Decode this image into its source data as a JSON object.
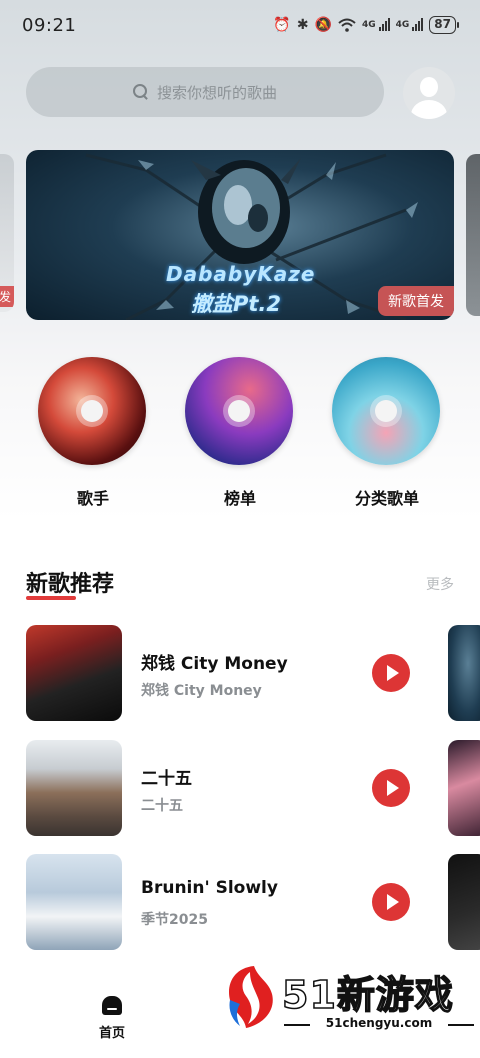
{
  "status_bar": {
    "time": "09:21",
    "net1": "4G",
    "net2": "4G",
    "battery": "87"
  },
  "search": {
    "placeholder": "搜索你想听的歌曲"
  },
  "banner": {
    "title": "DababyKaze",
    "subtitle": "撤盐Pt.2",
    "tag": "新歌首发",
    "left_peek_tag": "发"
  },
  "categories": [
    {
      "label": "歌手"
    },
    {
      "label": "榜单"
    },
    {
      "label": "分类歌单"
    }
  ],
  "new_songs": {
    "title": "新歌推荐",
    "more": "更多",
    "items": [
      {
        "title": "郑钱 City Money",
        "subtitle": "郑钱 City Money"
      },
      {
        "title": "二十五",
        "subtitle": "二十五"
      },
      {
        "title": "Brunin' Slowly",
        "subtitle": "季节2025"
      }
    ]
  },
  "bottom_nav": {
    "home_label": "首页"
  },
  "watermark": {
    "brand": "51新游戏",
    "url": "51chengyu.com"
  },
  "colors": {
    "accent": "#dd3535",
    "muted_text": "#8a8e92"
  }
}
